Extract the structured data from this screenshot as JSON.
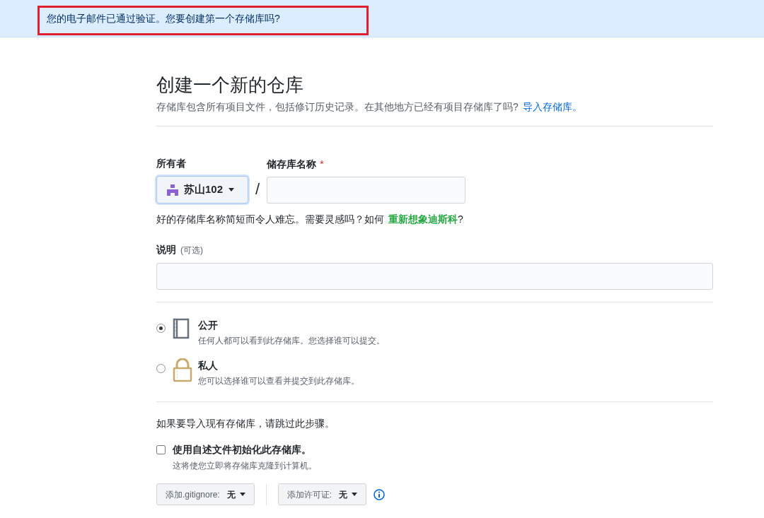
{
  "banner": {
    "text": "您的电子邮件已通过验证。您要创建第一个存储库吗?",
    "highlighted": true
  },
  "heading": "创建一个新的仓库",
  "subtitle": {
    "text": "存储库包含所有项目文件，包括修订历史记录。在其他地方已经有项目存储库了吗?",
    "link": "导入存储库。"
  },
  "owner": {
    "label": "所有者",
    "value": "苏山102"
  },
  "separator": "/",
  "repo_name": {
    "label": "储存库名称",
    "required_mark": "*"
  },
  "name_hint": {
    "text": "好的存储库名称简短而令人难忘。需要灵感吗？如何",
    "suggestion": "重新想象迪斯科",
    "end": "?"
  },
  "description": {
    "label": "说明",
    "optional": "(可选)"
  },
  "visibility": [
    {
      "kind": "book",
      "title": "公开",
      "description": "任何人都可以看到此存储库。您选择谁可以提交。",
      "selected": true
    },
    {
      "kind": "lock",
      "title": "私人",
      "description": "您可以选择谁可以查看并提交到此存储库。",
      "selected": false
    }
  ],
  "import_note": "如果要导入现有存储库，请跳过此步骤。",
  "readme": {
    "label": "使用自述文件初始化此存储库。",
    "description": "这将使您立即将存储库克隆到计算机。",
    "checked": false
  },
  "dropdowns": [
    {
      "label": "添加.gitignore:",
      "value": "无"
    },
    {
      "label": "添加许可证:",
      "value": "无"
    }
  ]
}
